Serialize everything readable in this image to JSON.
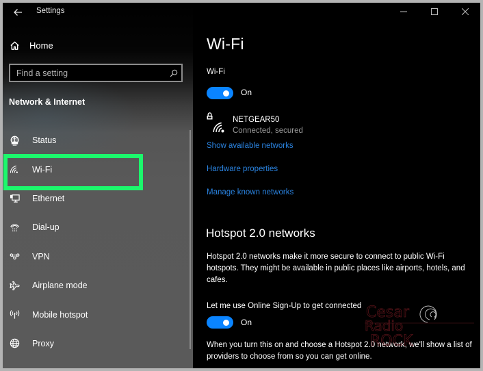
{
  "window": {
    "app_title": "Settings",
    "controls": {
      "minimize": "minimize-icon",
      "maximize": "maximize-icon",
      "close": "close-icon"
    }
  },
  "sidebar": {
    "home_label": "Home",
    "search": {
      "placeholder": "Find a setting",
      "value": ""
    },
    "section_title": "Network & Internet",
    "items": [
      {
        "label": "Status",
        "icon": "globe-status-icon",
        "selected": false
      },
      {
        "label": "Wi-Fi",
        "icon": "wifi-icon",
        "selected": true
      },
      {
        "label": "Ethernet",
        "icon": "ethernet-icon",
        "selected": false
      },
      {
        "label": "Dial-up",
        "icon": "dialup-phone-icon",
        "selected": false
      },
      {
        "label": "VPN",
        "icon": "vpn-icon",
        "selected": false
      },
      {
        "label": "Airplane mode",
        "icon": "airplane-icon",
        "selected": false
      },
      {
        "label": "Mobile hotspot",
        "icon": "mobile-hotspot-icon",
        "selected": false
      },
      {
        "label": "Proxy",
        "icon": "globe-icon",
        "selected": false
      }
    ],
    "highlight_color": "#1cf86c"
  },
  "main": {
    "page_title": "Wi-Fi",
    "wifi_toggle": {
      "label": "Wi-Fi",
      "state": "On",
      "on": true
    },
    "network": {
      "name": "NETGEAR50",
      "status": "Connected, secured"
    },
    "links": {
      "show_available": "Show available networks",
      "hardware_properties": "Hardware properties",
      "manage_known": "Manage known networks"
    },
    "hotspot": {
      "heading": "Hotspot 2.0 networks",
      "description": "Hotspot 2.0 networks make it more secure to connect to public Wi-Fi hotspots. They might be available in public places like airports, hotels, and cafes.",
      "signup_label": "Let me use Online Sign-Up to get connected",
      "signup_toggle": {
        "state": "On",
        "on": true
      },
      "signup_description": "When you turn this on and choose a Hotspot 2.0 network, we'll show a list of providers to choose from so you can get online."
    },
    "accent_color": "#0a84ff",
    "link_color": "#2a83e0"
  },
  "watermark": {
    "text": "Cesar Radio Rock"
  }
}
